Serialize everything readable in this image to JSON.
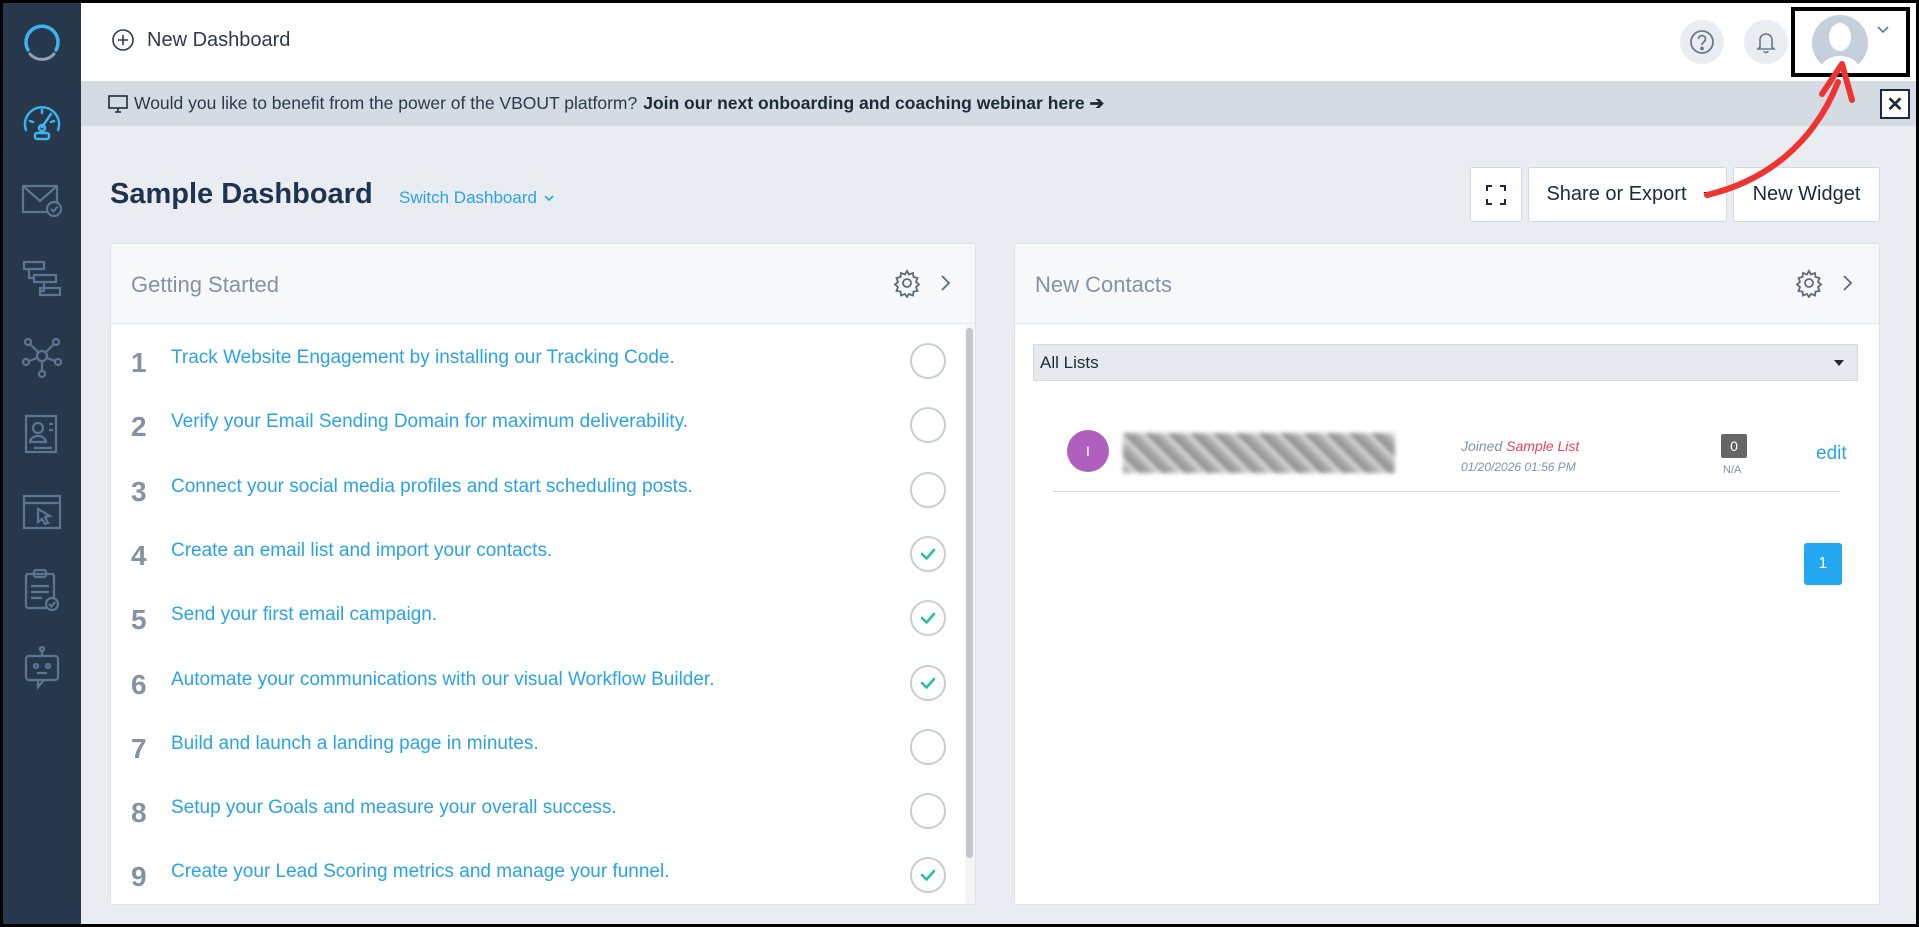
{
  "topbar": {
    "new_dashboard": "New Dashboard"
  },
  "banner": {
    "text": "Would you like to benefit from the power of the VBOUT platform?",
    "link": "Join our next onboarding and coaching webinar here ➔",
    "close": "✕"
  },
  "dashboard": {
    "title": "Sample Dashboard",
    "switch_label": "Switch Dashboard",
    "share_export": "Share or Export",
    "new_widget": "New Widget"
  },
  "getting_started": {
    "title": "Getting Started",
    "steps": [
      {
        "num": "1",
        "text": "Track Website Engagement by installing our Tracking Code.",
        "done": false
      },
      {
        "num": "2",
        "text": "Verify your Email Sending Domain for maximum deliverability.",
        "done": false
      },
      {
        "num": "3",
        "text": "Connect your social media profiles and start scheduling posts.",
        "done": false
      },
      {
        "num": "4",
        "text": "Create an email list and import your contacts.",
        "done": true
      },
      {
        "num": "5",
        "text": "Send your first email campaign.",
        "done": true
      },
      {
        "num": "6",
        "text": "Automate your communications with our visual Workflow Builder.",
        "done": true
      },
      {
        "num": "7",
        "text": "Build and launch a landing page in minutes.",
        "done": false
      },
      {
        "num": "8",
        "text": "Setup your Goals and measure your overall success.",
        "done": false
      },
      {
        "num": "9",
        "text": "Create your Lead Scoring metrics and manage your funnel.",
        "done": true
      }
    ]
  },
  "new_contacts": {
    "title": "New Contacts",
    "list_filter": "All Lists",
    "contact": {
      "initial": "I",
      "joined_prefix": "Joined",
      "list_name": "Sample List",
      "date": "01/20/2026 01:56 PM",
      "score": "0",
      "score_sub": "N/A",
      "edit": "edit"
    },
    "page": "1"
  },
  "colors": {
    "sidebar": "#27384c",
    "accent": "#2aa3e6",
    "check": "#2bbfa4",
    "annotation": "#ee3333"
  }
}
